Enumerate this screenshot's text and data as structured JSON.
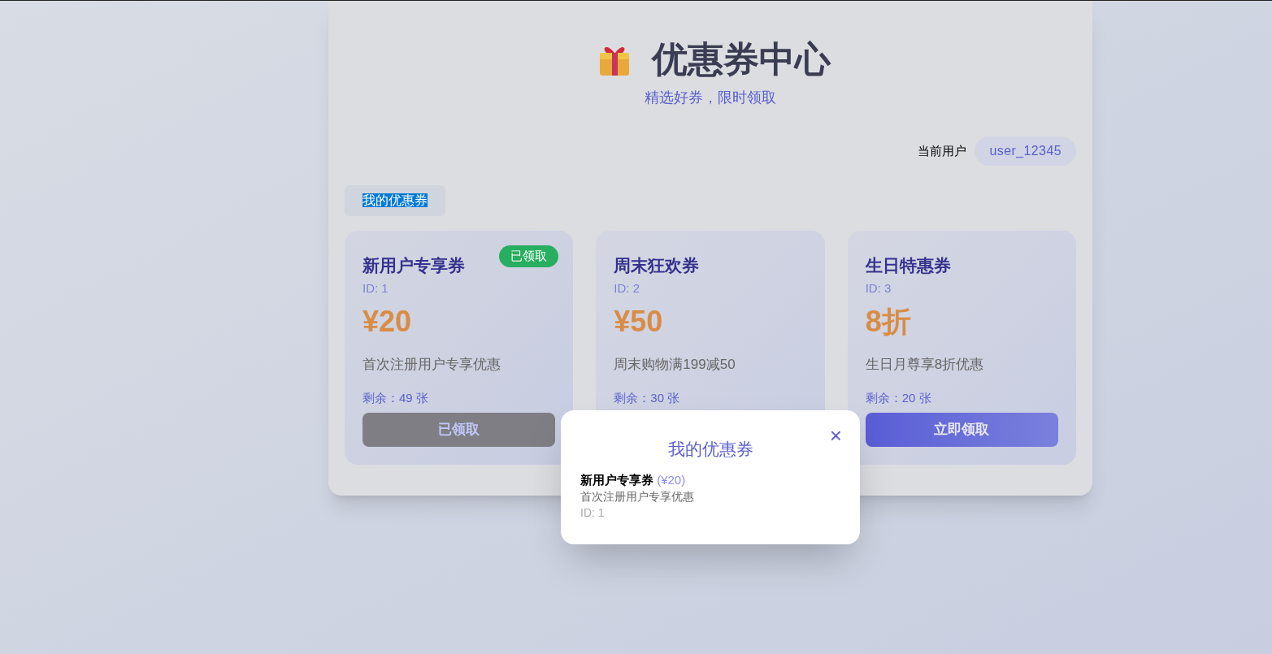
{
  "header": {
    "title": "优惠券中心",
    "subtitle": "精选好券，限时领取"
  },
  "user": {
    "label": "当前用户",
    "name": "user_12345"
  },
  "my_coupons_button": "我的优惠券",
  "coupons": [
    {
      "title": "新用户专享券",
      "id": "ID: 1",
      "value": "¥20",
      "description": "首次注册用户专享优惠",
      "remaining": "剩余：49 张",
      "claimed": true,
      "badge": "已领取",
      "button": "已领取"
    },
    {
      "title": "周末狂欢券",
      "id": "ID: 2",
      "value": "¥50",
      "description": "周末购物满199减50",
      "remaining": "剩余：30 张",
      "claimed": false
    },
    {
      "title": "生日特惠券",
      "id": "ID: 3",
      "value": "8折",
      "description": "生日月尊享8折优惠",
      "remaining": "剩余：20 张",
      "claimed": false,
      "button": "立即领取"
    }
  ],
  "modal": {
    "title": "我的优惠券",
    "close": "×",
    "items": [
      {
        "title": "新用户专享券",
        "value": "(¥20)",
        "description": "首次注册用户专享优惠",
        "id": "ID: 1"
      }
    ]
  }
}
